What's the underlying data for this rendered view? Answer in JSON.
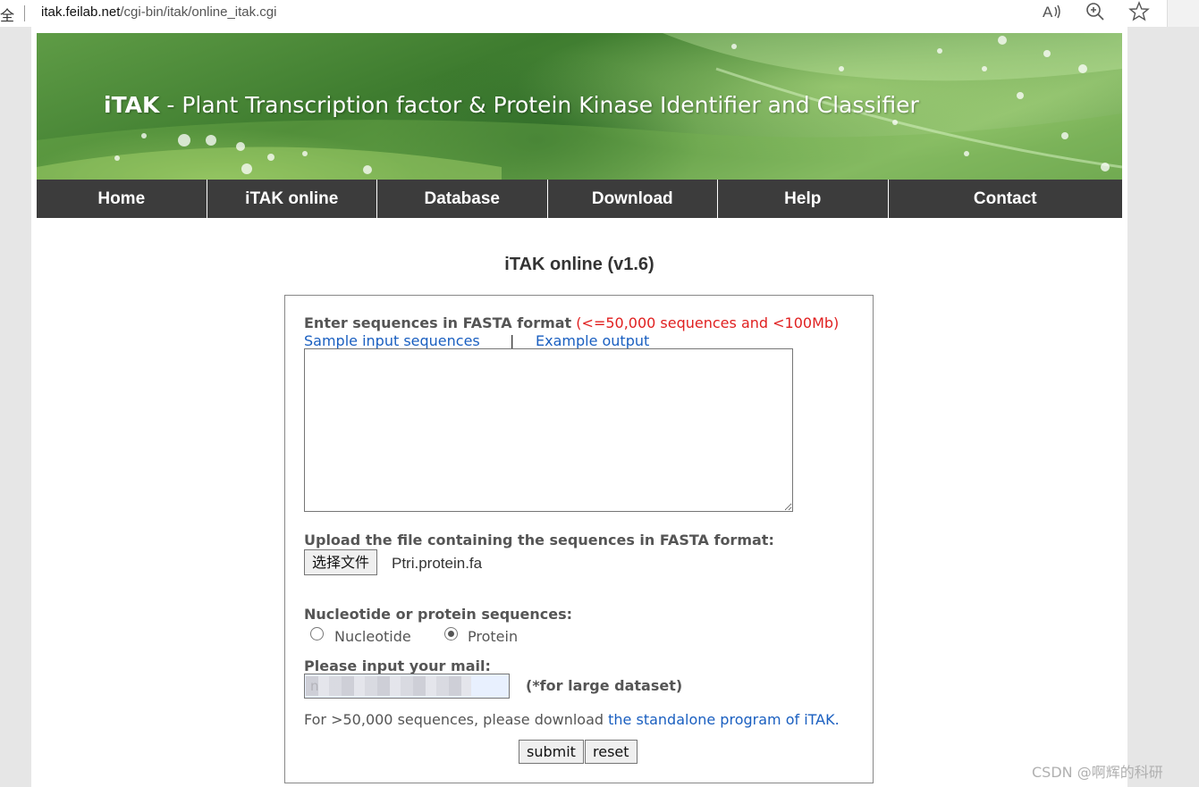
{
  "browser": {
    "partial_left_text": "全",
    "url_host": "itak.feilab.net",
    "url_path": "/cgi-bin/itak/online_itak.cgi"
  },
  "banner": {
    "title_bold": "iTAK",
    "title_rest": " - Plant Transcription factor & Protein Kinase Identifier and Classifier"
  },
  "nav": {
    "items": [
      "Home",
      "iTAK online",
      "Database",
      "Download",
      "Help",
      "Contact"
    ]
  },
  "page": {
    "heading": "iTAK online (v1.6)"
  },
  "form": {
    "seq_label": "Enter sequences in FASTA format",
    "seq_limit": " (<=50,000 sequences and <100Mb)",
    "sample_link": "Sample input sequences",
    "divider": "|",
    "example_link": "Example output",
    "upload_label": "Upload the file containing the sequences in FASTA format:",
    "file_button": "选择文件",
    "file_name": "Ptri.protein.fa",
    "type_label": "Nucleotide or protein sequences:",
    "option_nucleotide": "Nucleotide",
    "option_protein": "Protein",
    "mail_label": "Please input your mail:",
    "mail_value": "n",
    "large_note": "(*for large dataset)",
    "note_text": "For >50,000 sequences, please download ",
    "note_link": "the standalone program of iTAK.",
    "submit": "submit",
    "reset": "reset"
  },
  "watermark": "CSDN @啊辉的科研"
}
